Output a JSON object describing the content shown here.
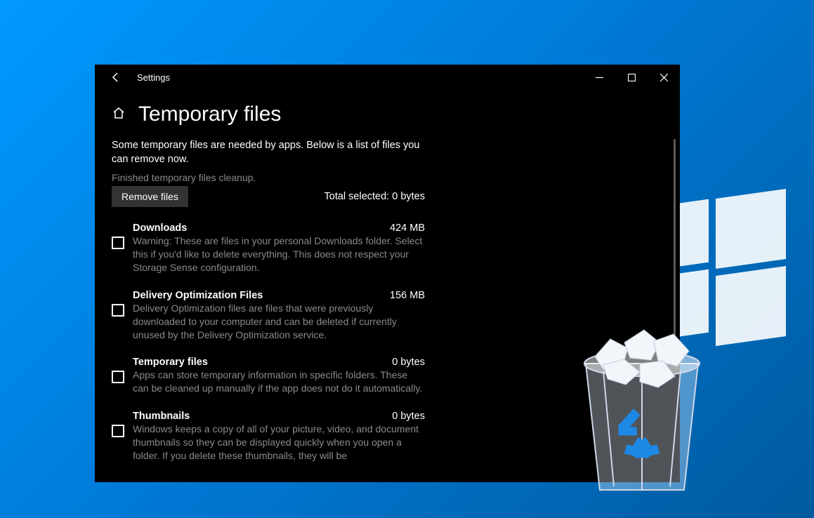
{
  "window": {
    "app_name": "Settings",
    "page_title": "Temporary files",
    "intro": "Some temporary files are needed by apps. Below is a list of files you can remove now.",
    "status": "Finished temporary files cleanup.",
    "remove_button": "Remove files",
    "total_selected_label": "Total selected: 0 bytes"
  },
  "items": [
    {
      "title": "Downloads",
      "size": "424 MB",
      "description": "Warning: These are files in your personal Downloads folder. Select this if you'd like to delete everything. This does not respect your Storage Sense configuration."
    },
    {
      "title": "Delivery Optimization Files",
      "size": "156 MB",
      "description": "Delivery Optimization files are files that were previously downloaded to your computer and can be deleted if currently unused by the Delivery Optimization service."
    },
    {
      "title": "Temporary files",
      "size": "0 bytes",
      "description": "Apps can store temporary information in specific folders. These can be cleaned up manually if the app does not do it automatically."
    },
    {
      "title": "Thumbnails",
      "size": "0 bytes",
      "description": "Windows keeps a copy of all of your picture, video, and document thumbnails so they can be displayed quickly when you open a folder. If you delete these thumbnails, they will be"
    }
  ]
}
